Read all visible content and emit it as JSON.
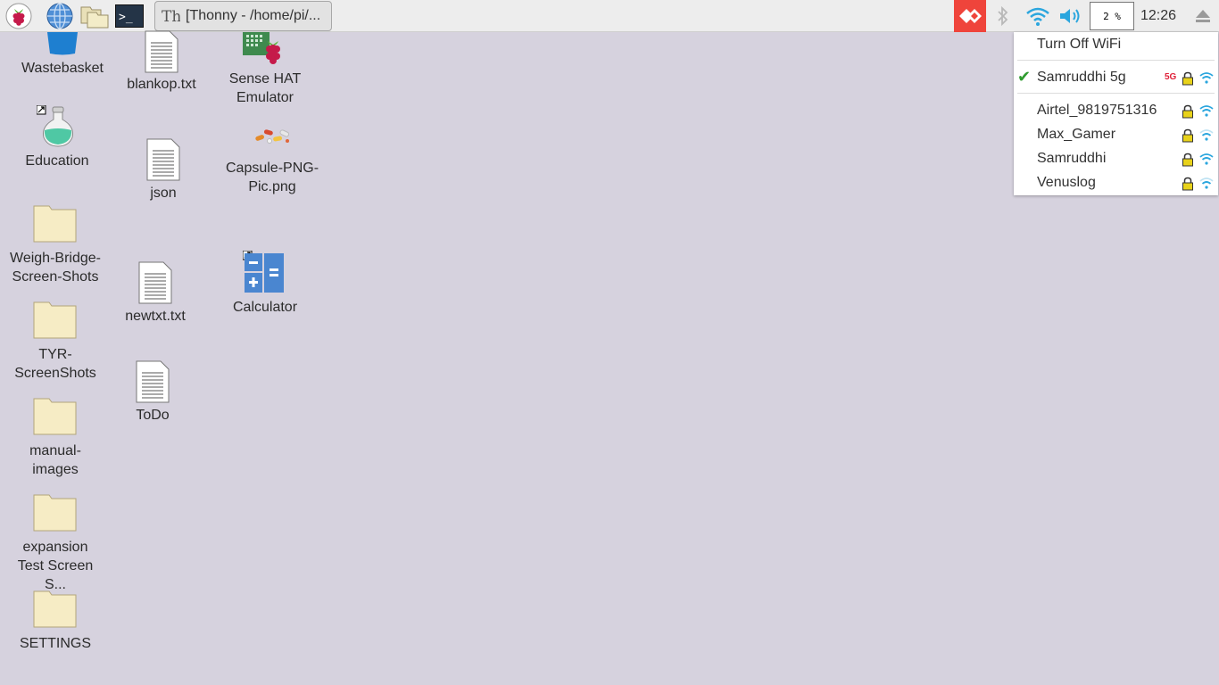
{
  "taskbar": {
    "launchers": [
      {
        "name": "raspberry-menu",
        "icon": "raspberry-icon"
      },
      {
        "name": "web-browser",
        "icon": "globe-icon"
      },
      {
        "name": "file-manager",
        "icon": "folders-icon"
      },
      {
        "name": "terminal",
        "icon": "terminal-icon"
      }
    ],
    "task_label": "[Thonny  -  /home/pi/...",
    "cpu_text": "2 %",
    "clock": "12:26",
    "terminal_glyph": ">_"
  },
  "desktop": {
    "icons": [
      {
        "label": "Wastebasket",
        "icon": "trash-icon"
      },
      {
        "label": "Education",
        "icon": "flask-icon"
      },
      {
        "label": "Weigh-Bridge-\nScreen-Shots",
        "icon": "folder-icon"
      },
      {
        "label": "TYR-\nScreenShots",
        "icon": "folder-icon"
      },
      {
        "label": "manual-\nimages",
        "icon": "folder-icon"
      },
      {
        "label": "expansion\nTest Screen S...",
        "icon": "folder-icon"
      },
      {
        "label": "SETTINGS",
        "icon": "folder-icon"
      },
      {
        "label": "blankop.txt",
        "icon": "text-file-icon"
      },
      {
        "label": "json",
        "icon": "text-file-icon"
      },
      {
        "label": "newtxt.txt",
        "icon": "text-file-icon"
      },
      {
        "label": "ToDo",
        "icon": "text-file-icon"
      },
      {
        "label": "Sense HAT\nEmulator",
        "icon": "sense-hat-icon"
      },
      {
        "label": "Capsule-PNG-\nPic.png",
        "icon": "capsule-image-icon"
      },
      {
        "label": "Calculator",
        "icon": "calculator-icon"
      }
    ]
  },
  "wifi_menu": {
    "turn_off": "Turn Off WiFi",
    "connected": {
      "ssid": "Samruddhi 5g",
      "band": "5G"
    },
    "networks": [
      {
        "ssid": "Airtel_9819751316",
        "signal": "strong"
      },
      {
        "ssid": "Max_Gamer",
        "signal": "weak"
      },
      {
        "ssid": "Samruddhi",
        "signal": "strong"
      },
      {
        "ssid": "Venuslog",
        "signal": "weak"
      }
    ]
  },
  "colors": {
    "desktop_bg": "#d6d2de",
    "taskbar_bg": "#ededed",
    "anydesk_red": "#ef443b",
    "wifi_blue": "#2ba6de",
    "lock_yellow": "#e8d21a",
    "check_green": "#2e9b2e"
  }
}
